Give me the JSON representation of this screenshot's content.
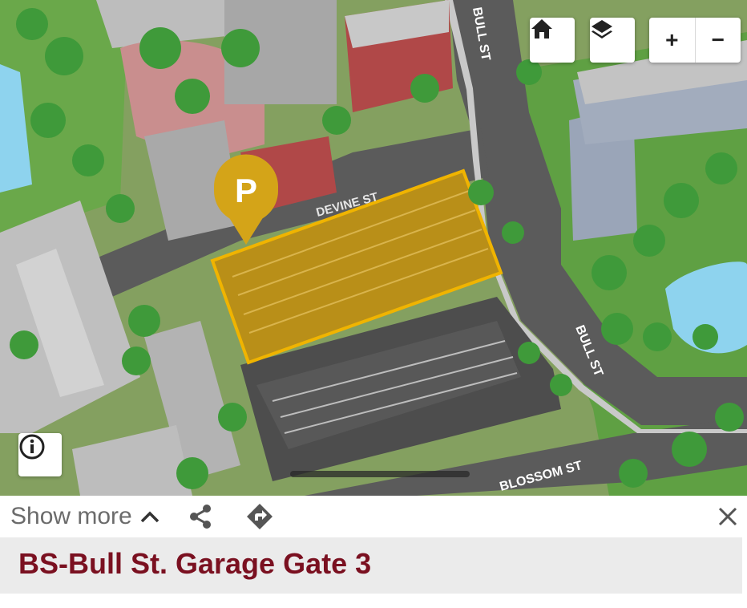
{
  "map": {
    "street_labels": {
      "bull_st_top": "BULL ST",
      "devine_st": "DEVINE ST",
      "bull_st_right": "BULL ST",
      "blossom_st": "BLOSSOM ST"
    },
    "marker_letter": "P",
    "highlight_color": "#d4a418",
    "controls": {
      "home": "home-icon",
      "layers": "layers-icon",
      "zoom_in_label": "+",
      "zoom_out_label": "−",
      "info": "info-icon"
    }
  },
  "panel": {
    "show_more_label": "Show more",
    "title": "BS-Bull St. Garage Gate 3",
    "title_color": "#7a1020",
    "icons": [
      "chevron-up-icon",
      "share-icon",
      "directions-icon",
      "close-icon"
    ]
  }
}
